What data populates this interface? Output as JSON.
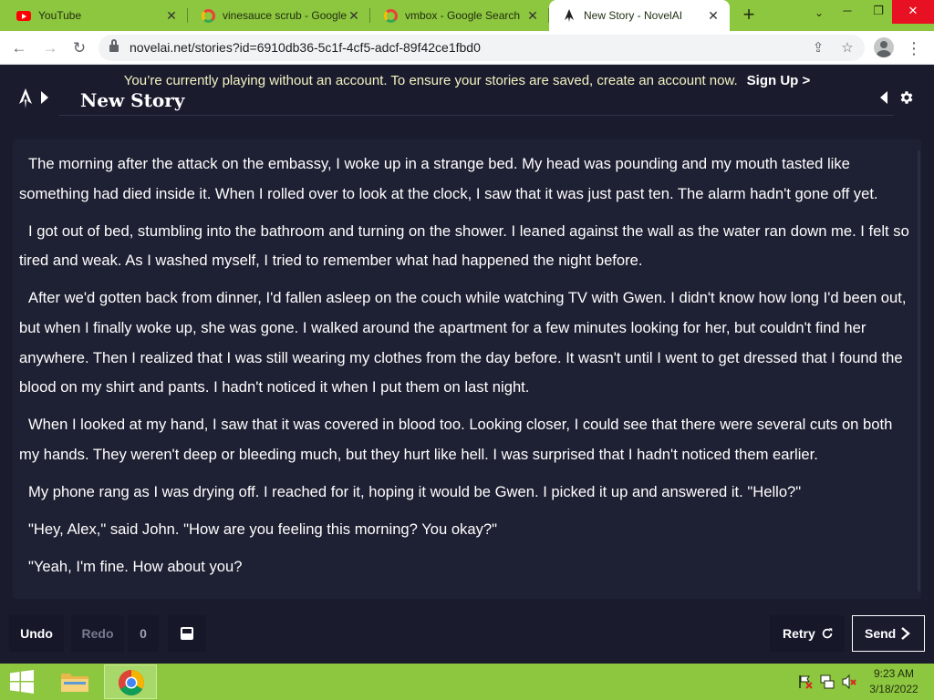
{
  "browser": {
    "tabs": [
      {
        "title": "YouTube",
        "favicon": "youtube-icon",
        "active": false
      },
      {
        "title": "vinesauce scrub - Google",
        "favicon": "google-icon",
        "active": false
      },
      {
        "title": "vmbox - Google Search",
        "favicon": "google-icon",
        "active": false
      },
      {
        "title": "New Story - NovelAI",
        "favicon": "novelai-icon",
        "active": true
      }
    ],
    "new_tab_label": "+",
    "tab_list_label": "⌄",
    "window_controls": {
      "minimize": "─",
      "restore": "❐",
      "close": "✕"
    },
    "url": "novelai.net/stories?id=6910db36-5c1f-4cf5-adcf-89f42ce1fbd0",
    "nav": {
      "back": "←",
      "forward": "→",
      "reload": "↻"
    },
    "omnibox_icons": {
      "share": "⇪",
      "bookmark": "☆"
    },
    "menu": "⋮",
    "accent_color": "#8dc63f"
  },
  "banner": {
    "text": "You’re currently playing without an account. To ensure your stories are saved, create an account now.",
    "signup": "Sign Up >"
  },
  "story": {
    "title": "New Story",
    "paragraphs": [
      "The morning after the attack on the embassy, I woke up in a strange bed. My head was pounding and my mouth tasted like something had died inside it. When I rolled over to look at the clock, I saw that it was just past ten. The alarm hadn't gone off yet.",
      "I got out of bed, stumbling into the bathroom and turning on the shower. I leaned against the wall as the water ran down me. I felt so tired and weak. As I washed myself, I tried to remember what had happened the night before.",
      "After we'd gotten back from dinner, I'd fallen asleep on the couch while watching TV with Gwen. I didn't know how long I'd been out, but when I finally woke up, she was gone. I walked around the apartment for a few minutes looking for her, but couldn't find her anywhere. Then I realized that I was still wearing my clothes from the day before. It wasn't until I went to get dressed that I found the blood on my shirt and pants. I hadn't noticed it when I put them on last night.",
      "When I looked at my hand, I saw that it was covered in blood too. Looking closer, I could see that there were several cuts on both my hands. They weren't deep or bleeding much, but they hurt like hell. I was surprised that I hadn't noticed them earlier.",
      "My phone rang as I was drying off. I reached for it, hoping it would be Gwen. I picked it up and answered it. \"Hello?\"",
      "\"Hey, Alex,\" said John. \"How are you feeling this morning? You okay?\"",
      "\"Yeah, I'm fine. How about you?"
    ]
  },
  "controls": {
    "undo": "Undo",
    "redo": "Redo",
    "redo_count": "0",
    "retry": "Retry",
    "send": "Send"
  },
  "taskbar": {
    "apps": [
      "file-explorer",
      "google-chrome"
    ],
    "time": "9:23 AM",
    "date": "3/18/2022"
  }
}
